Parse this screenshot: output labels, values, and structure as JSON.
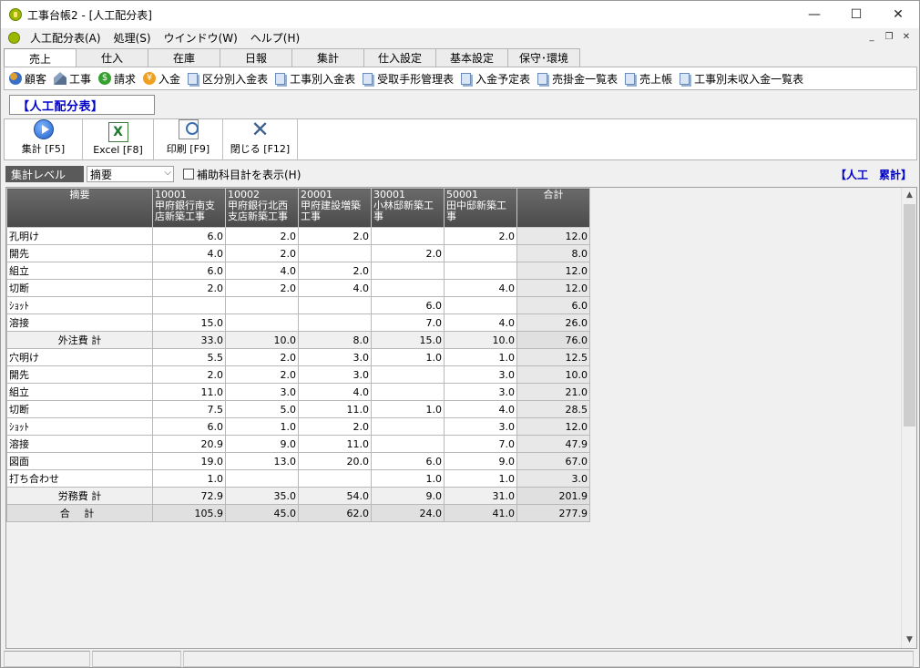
{
  "window": {
    "title": "工事台帳2 - [人工配分表]",
    "minimize": "—",
    "maximize": "☐",
    "close": "✕"
  },
  "menu": {
    "items": [
      "人工配分表(A)",
      "処理(S)",
      "ウインドウ(W)",
      "ヘルプ(H)"
    ]
  },
  "mdi": {
    "minimize": "_",
    "restore": "❐",
    "close": "✕"
  },
  "tabs": [
    "売上",
    "仕入",
    "在庫",
    "日報",
    "集計",
    "仕入設定",
    "基本設定",
    "保守･環境"
  ],
  "quick_links": [
    "顧客",
    "工事",
    "請求",
    "入金",
    "区分別入金表",
    "工事別入金表",
    "受取手形管理表",
    "入金予定表",
    "売掛金一覧表",
    "売上帳",
    "工事別未収入金一覧表"
  ],
  "section_title": "【人工配分表】",
  "toolbar": {
    "aggregate": "集計 [F5]",
    "excel": "Excel [F8]",
    "print": "印刷 [F9]",
    "close": "閉じる [F12]"
  },
  "filter": {
    "level_label": "集計レベル",
    "level_value": "摘要",
    "subaccount_label": "補助科目計を表示(H)",
    "right_label": "【人工　累計】"
  },
  "grid": {
    "headers": {
      "summary": "摘要",
      "cols": [
        {
          "code": "10001",
          "name": "甲府銀行南支店新築工事"
        },
        {
          "code": "10002",
          "name": "甲府銀行北西支店新築工事"
        },
        {
          "code": "20001",
          "name": "甲府建設増築工事"
        },
        {
          "code": "30001",
          "name": "小林邸新築工事"
        },
        {
          "code": "50001",
          "name": "田中邸新築工事"
        }
      ],
      "total": "合計"
    },
    "rows": [
      {
        "label": "孔明け",
        "v": [
          "6.0",
          "2.0",
          "2.0",
          "",
          "2.0"
        ],
        "total": "12.0"
      },
      {
        "label": "開先",
        "v": [
          "4.0",
          "2.0",
          "",
          "2.0",
          ""
        ],
        "total": "8.0"
      },
      {
        "label": "組立",
        "v": [
          "6.0",
          "4.0",
          "2.0",
          "",
          ""
        ],
        "total": "12.0"
      },
      {
        "label": "切断",
        "v": [
          "2.0",
          "2.0",
          "4.0",
          "",
          "4.0"
        ],
        "total": "12.0"
      },
      {
        "label": "ｼｮｯﾄ",
        "v": [
          "",
          "",
          "",
          "6.0",
          ""
        ],
        "total": "6.0"
      },
      {
        "label": "溶接",
        "v": [
          "15.0",
          "",
          "",
          "7.0",
          "4.0"
        ],
        "total": "26.0"
      },
      {
        "label": "外注費 計",
        "v": [
          "33.0",
          "10.0",
          "8.0",
          "15.0",
          "10.0"
        ],
        "total": "76.0",
        "type": "sub"
      },
      {
        "label": "穴明け",
        "v": [
          "5.5",
          "2.0",
          "3.0",
          "1.0",
          "1.0"
        ],
        "total": "12.5"
      },
      {
        "label": "開先",
        "v": [
          "2.0",
          "2.0",
          "3.0",
          "",
          "3.0"
        ],
        "total": "10.0"
      },
      {
        "label": "組立",
        "v": [
          "11.0",
          "3.0",
          "4.0",
          "",
          "3.0"
        ],
        "total": "21.0"
      },
      {
        "label": "切断",
        "v": [
          "7.5",
          "5.0",
          "11.0",
          "1.0",
          "4.0"
        ],
        "total": "28.5"
      },
      {
        "label": "ｼｮｯﾄ",
        "v": [
          "6.0",
          "1.0",
          "2.0",
          "",
          "3.0"
        ],
        "total": "12.0"
      },
      {
        "label": "溶接",
        "v": [
          "20.9",
          "9.0",
          "11.0",
          "",
          "7.0"
        ],
        "total": "47.9"
      },
      {
        "label": "図面",
        "v": [
          "19.0",
          "13.0",
          "20.0",
          "6.0",
          "9.0"
        ],
        "total": "67.0"
      },
      {
        "label": "打ち合わせ",
        "v": [
          "1.0",
          "",
          "",
          "1.0",
          "1.0"
        ],
        "total": "3.0"
      },
      {
        "label": "労務費 計",
        "v": [
          "72.9",
          "35.0",
          "54.0",
          "9.0",
          "31.0"
        ],
        "total": "201.9",
        "type": "sub"
      },
      {
        "label": "合 計",
        "v": [
          "105.9",
          "45.0",
          "62.0",
          "24.0",
          "41.0"
        ],
        "total": "277.9",
        "type": "grand"
      }
    ]
  }
}
